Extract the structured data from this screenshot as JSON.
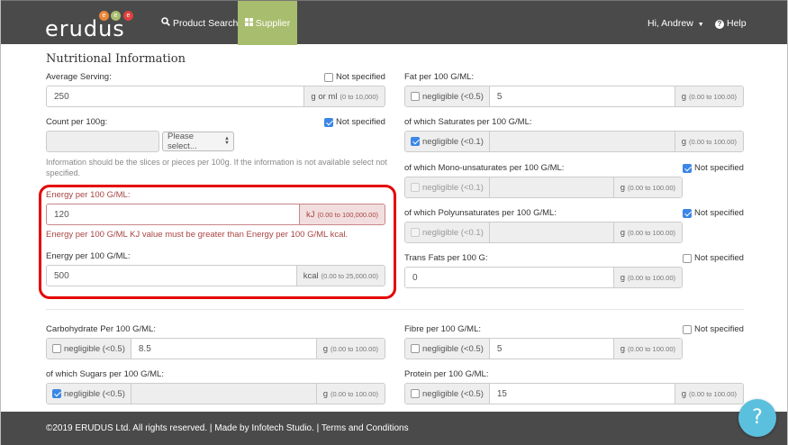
{
  "brand": {
    "name": "erudus",
    "dots": [
      "e",
      "e",
      "e"
    ],
    "colors": [
      "#e8873a",
      "#a9bd6e",
      "#e04040"
    ]
  },
  "nav": {
    "product_search": "Product Search",
    "supplier": "Supplier",
    "user": "Hi, Andrew",
    "help": "Help"
  },
  "section_title": "Nutritional Information",
  "not_specified": "Not specified",
  "left": {
    "average_serving": {
      "label": "Average Serving:",
      "value": "250",
      "unit": "g or ml",
      "range": "(0 to 10,000)",
      "not_specified": false
    },
    "count": {
      "label": "Count per 100g:",
      "value": "",
      "select": "Please select...",
      "not_specified": true,
      "help": "Information should be the slices or pieces per 100g. If the information is not available select not specified."
    },
    "energy_kj": {
      "label": "Energy per 100 G/ML:",
      "value": "120",
      "unit": "kJ",
      "range": "(0.00 to 100,000.00)",
      "error": "Energy per 100 G/ML KJ value must be greater than Energy per 100 G/ML kcal."
    },
    "energy_kcal": {
      "label": "Energy per 100 G/ML:",
      "value": "500",
      "unit": "kcal",
      "range": "(0.00 to 25,000.00)"
    },
    "carbohydrate": {
      "label": "Carbohydrate Per 100 G/ML:",
      "negligible": "negligible (<0.5)",
      "value": "8.5",
      "unit": "g",
      "range": "(0.00 to 100.00)",
      "checked": false
    },
    "sugars": {
      "label": "of which Sugars per 100 G/ML:",
      "negligible": "negligible (<0.5)",
      "value": "",
      "unit": "g",
      "range": "(0.00 to 100.00)",
      "checked": true
    }
  },
  "right": {
    "fat": {
      "label": "Fat per 100 G/ML:",
      "negligible": "negligible (<0.5)",
      "value": "5",
      "unit": "g",
      "range": "(0.00 to 100.00)",
      "checked": false
    },
    "saturates": {
      "label": "of which Saturates per 100 G/ML:",
      "negligible": "negligible (<0.1)",
      "value": "",
      "unit": "g",
      "range": "(0.00 to 100.00)",
      "checked": true
    },
    "mono": {
      "label": "of which Mono-unsaturates per 100 G/ML:",
      "negligible": "negligible (<0.1)",
      "value": "",
      "unit": "g",
      "range": "(0.00 to 100.00)",
      "not_specified": true
    },
    "poly": {
      "label": "of which Polyunsaturates per 100 G/ML:",
      "negligible": "negligible (<0.1)",
      "value": "",
      "unit": "g",
      "range": "(0.00 to 100.00)",
      "not_specified": true
    },
    "trans": {
      "label": "Trans Fats per 100 G:",
      "value": "0",
      "unit": "g",
      "range": "(0.00 to 100.00)",
      "not_specified": false
    },
    "fibre": {
      "label": "Fibre per 100 G/ML:",
      "negligible": "negligible (<0.5)",
      "value": "5",
      "unit": "g",
      "range": "(0.00 to 100.00)",
      "not_specified": false
    },
    "protein": {
      "label": "Protein per 100 G/ML:",
      "negligible": "negligible (<0.5)",
      "value": "15",
      "unit": "g",
      "range": "(0.00 to 100.00)",
      "checked": false
    }
  },
  "footer": {
    "text": "©2019 ERUDUS Ltd. All rights reserved. | Made by Infotech Studio. | Terms and Conditions"
  },
  "fab": {
    "label": "?"
  }
}
